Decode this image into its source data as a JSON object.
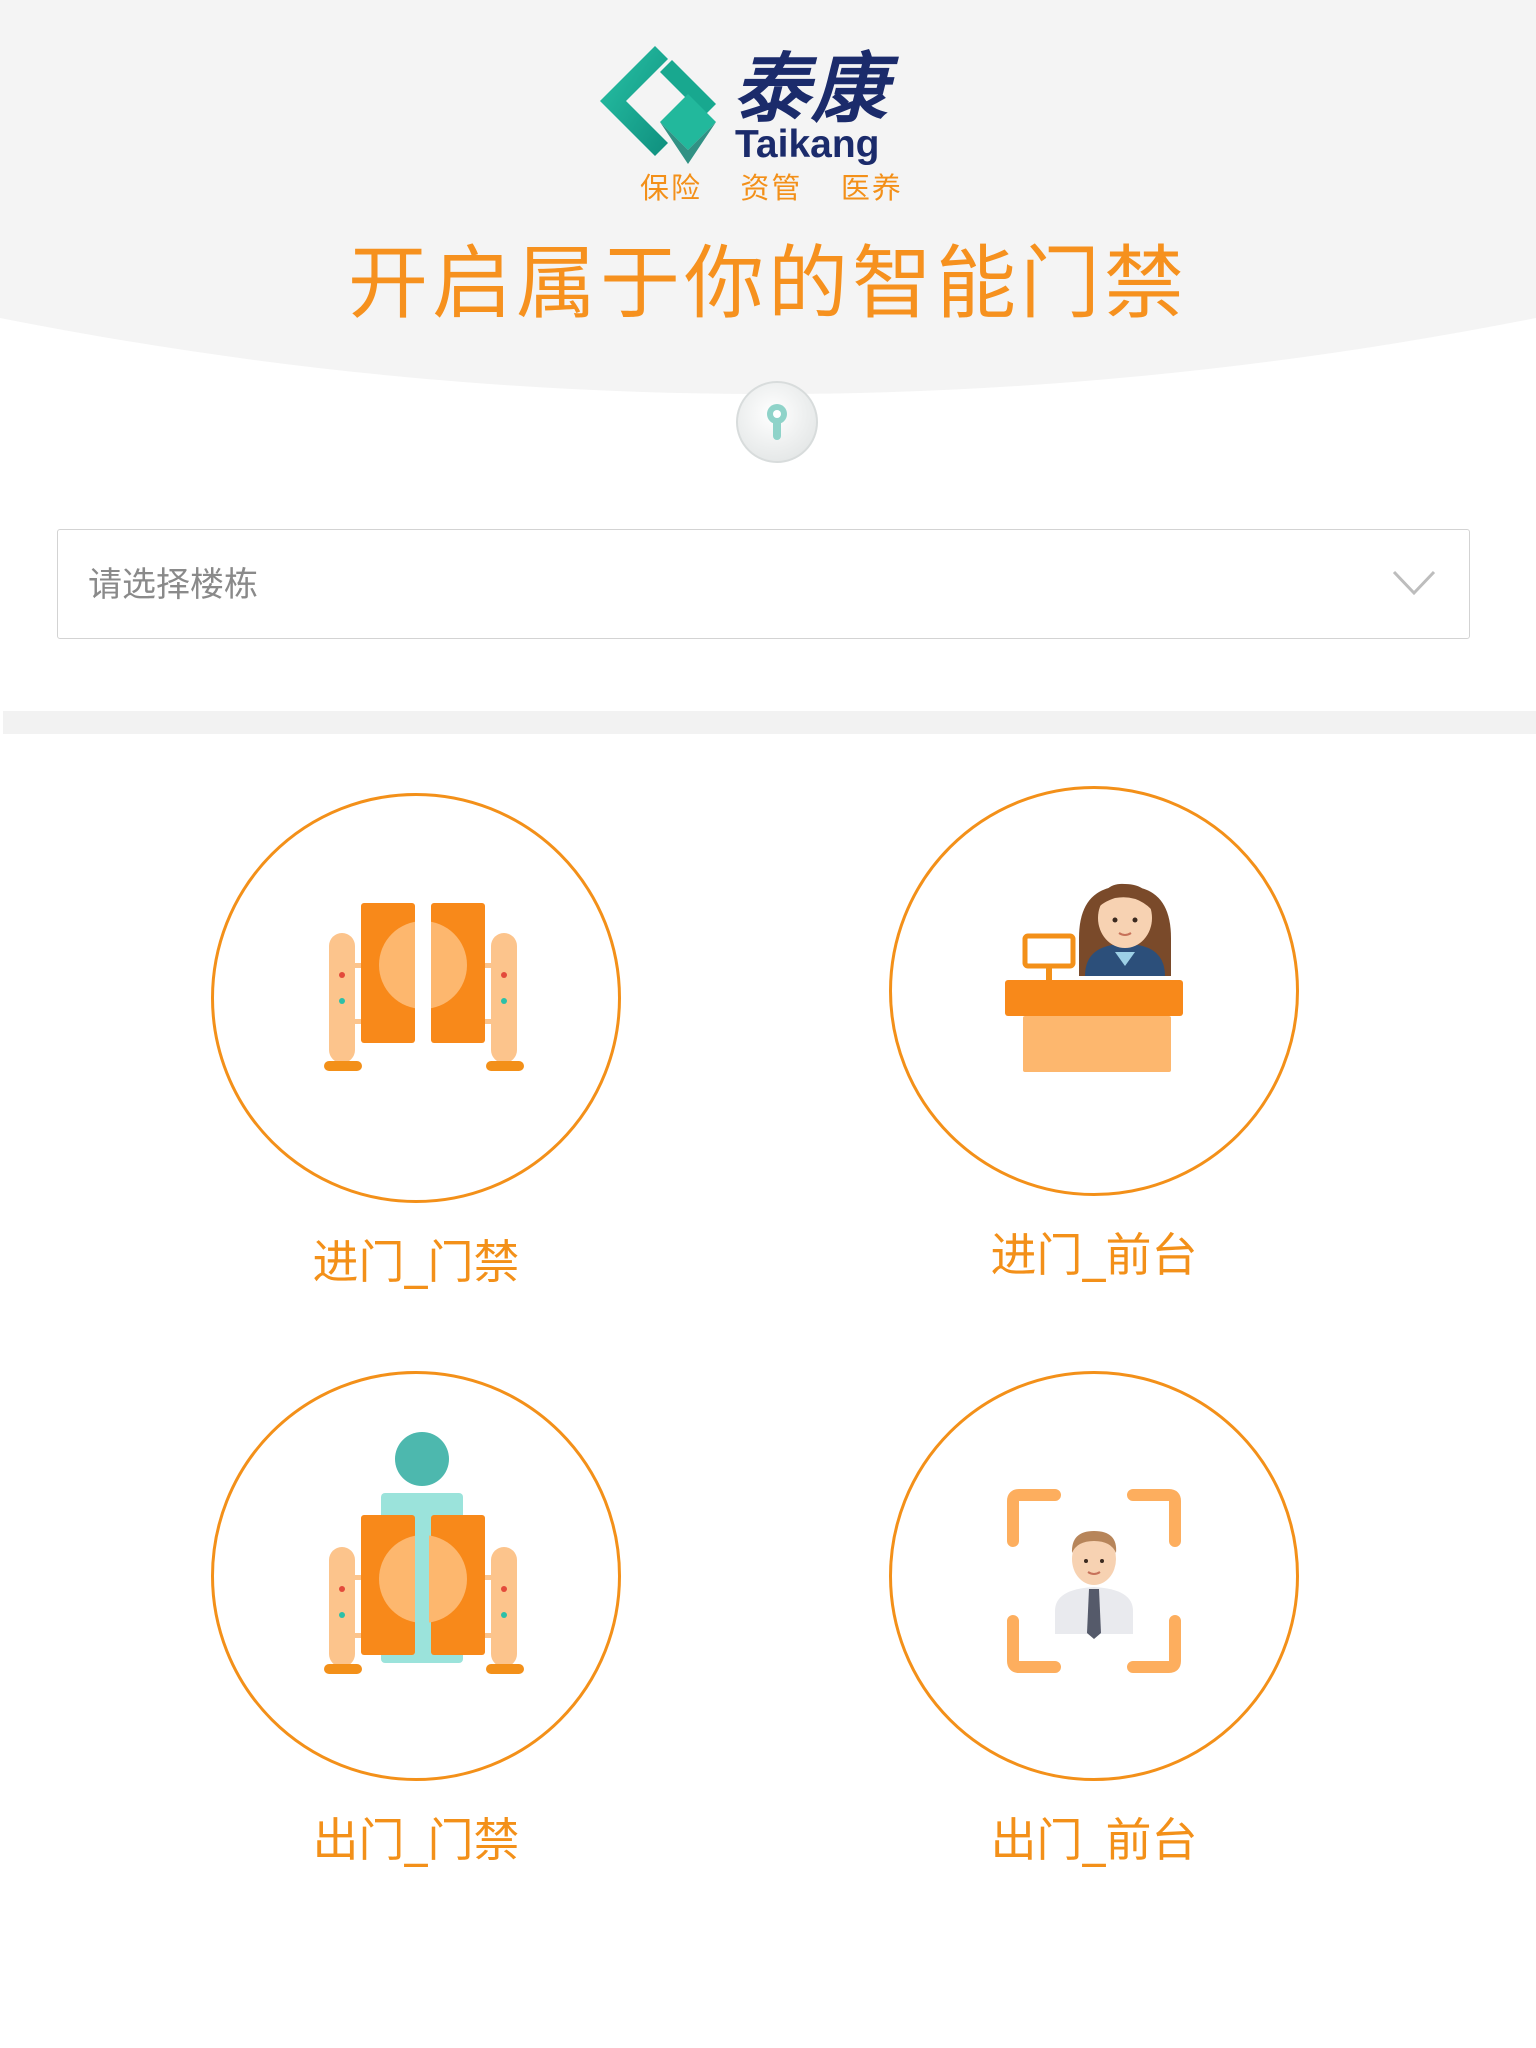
{
  "brand": {
    "name_cn": "泰康",
    "name_en": "Taikang",
    "slogan": "保险  资管  医养"
  },
  "headline": "开启属于你的智能门禁",
  "building_select": {
    "placeholder": "请选择楼栋",
    "icon": "chevron-down-icon"
  },
  "actions": [
    {
      "label": "进门_门禁",
      "icon": "gate-enter-icon"
    },
    {
      "label": "进门_前台",
      "icon": "reception-desk-icon"
    },
    {
      "label": "出门_门禁",
      "icon": "gate-exit-icon"
    },
    {
      "label": "出门_前台",
      "icon": "face-scan-icon"
    }
  ],
  "colors": {
    "accent_orange": "#f39019",
    "light_orange": "#fdb76e",
    "brand_navy": "#1b2b6b",
    "brand_teal": "#1aa58d",
    "header_bg": "#f4f4f4"
  }
}
